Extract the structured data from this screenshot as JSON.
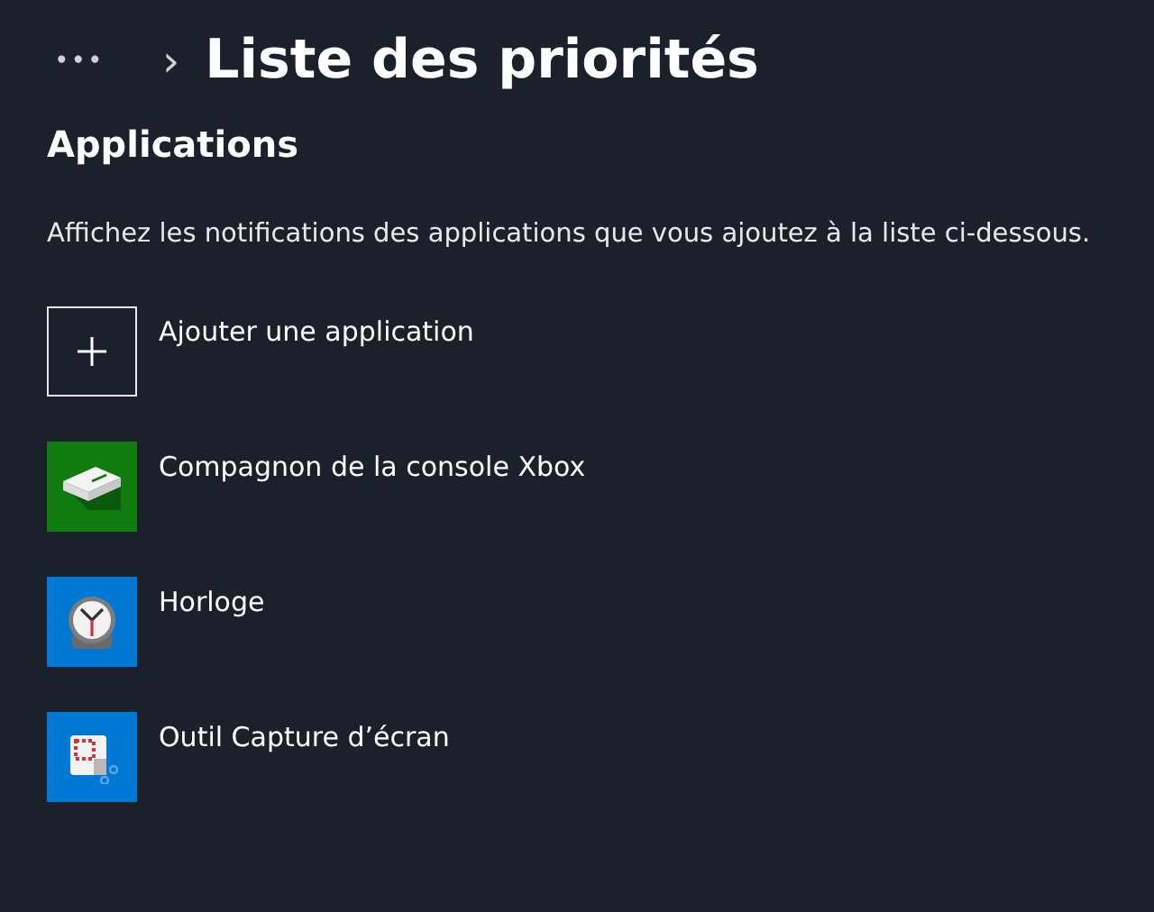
{
  "breadcrumb": {
    "more": "•••",
    "separator": "›",
    "title": "Liste des priorités"
  },
  "section": {
    "title": "Applications",
    "description": "Affichez les notifications des applications que vous ajoutez à la liste ci-dessous."
  },
  "apps": [
    {
      "kind": "add",
      "label": "Ajouter une application"
    },
    {
      "kind": "console",
      "label": "Compagnon de la console Xbox",
      "color": "#107c10"
    },
    {
      "kind": "clock",
      "label": "Horloge",
      "color": "#0078d4"
    },
    {
      "kind": "snip",
      "label": "Outil Capture d’écran",
      "color": "#0078d4"
    }
  ]
}
